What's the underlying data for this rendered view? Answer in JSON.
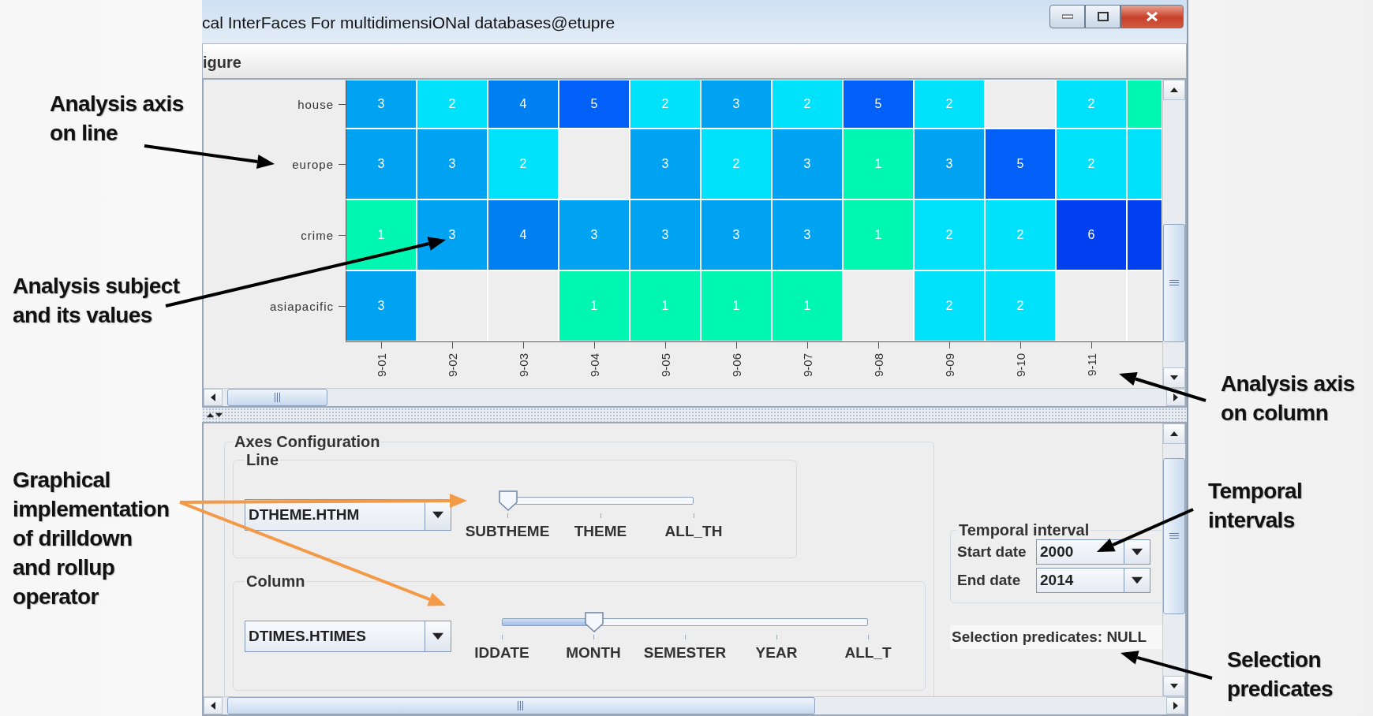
{
  "window": {
    "title": "cal InterFaces For multidimensiONal databases@etupre"
  },
  "menu": {
    "items": [
      "igure"
    ]
  },
  "heatmap": {
    "rows": [
      {
        "label": "house",
        "cells": [
          {
            "value": "3",
            "color": "#00a2f2"
          },
          {
            "value": "2",
            "color": "#00e2fc"
          },
          {
            "value": "4",
            "color": "#0080f0"
          },
          {
            "value": "5",
            "color": "#0060f8"
          },
          {
            "value": "2",
            "color": "#00e2fc"
          },
          {
            "value": "3",
            "color": "#00a2f2"
          },
          {
            "value": "2",
            "color": "#00e2fc"
          },
          {
            "value": "5",
            "color": "#0060f8"
          },
          {
            "value": "2",
            "color": "#00e2fc"
          },
          null,
          {
            "value": "2",
            "color": "#00e2fc"
          },
          {
            "color": "#00f7b2"
          }
        ]
      },
      {
        "label": "europe",
        "cells": [
          {
            "value": "3",
            "color": "#00a2f2"
          },
          {
            "value": "3",
            "color": "#00a2f2"
          },
          {
            "value": "2",
            "color": "#00e2fc"
          },
          null,
          {
            "value": "3",
            "color": "#00a2f2"
          },
          {
            "value": "2",
            "color": "#00e2fc"
          },
          {
            "value": "3",
            "color": "#00a2f2"
          },
          {
            "value": "1",
            "color": "#00f7b2"
          },
          {
            "value": "3",
            "color": "#00a2f2"
          },
          {
            "value": "5",
            "color": "#0060f8"
          },
          {
            "value": "2",
            "color": "#00e2fc"
          },
          {
            "color": "#00e2fc"
          }
        ]
      },
      {
        "label": "crime",
        "cells": [
          {
            "value": "1",
            "color": "#00f7b2"
          },
          {
            "value": "3",
            "color": "#00a2f2"
          },
          {
            "value": "4",
            "color": "#0080f0"
          },
          {
            "value": "3",
            "color": "#00a2f2"
          },
          {
            "value": "3",
            "color": "#00a2f2"
          },
          {
            "value": "3",
            "color": "#00a2f2"
          },
          {
            "value": "3",
            "color": "#00a2f2"
          },
          {
            "value": "1",
            "color": "#00f7b2"
          },
          {
            "value": "2",
            "color": "#00e2fc"
          },
          {
            "value": "2",
            "color": "#00e2fc"
          },
          {
            "value": "6",
            "color": "#0040f0"
          },
          {
            "color": "#0040f0"
          }
        ]
      },
      {
        "label": "asiapacific",
        "cells": [
          {
            "value": "3",
            "color": "#00a2f2"
          },
          null,
          null,
          {
            "value": "1",
            "color": "#00f7b2"
          },
          {
            "value": "1",
            "color": "#00f7b2"
          },
          {
            "value": "1",
            "color": "#00f7b2"
          },
          {
            "value": "1",
            "color": "#00f7b2"
          },
          null,
          {
            "value": "2",
            "color": "#00e2fc"
          },
          {
            "value": "2",
            "color": "#00e2fc"
          },
          null,
          null
        ]
      }
    ],
    "bottom_axis": {
      "tick_labels": [
        "9-01",
        "9-02",
        "9-03",
        "9-04",
        "9-05",
        "9-06",
        "9-07",
        "9-08",
        "9-09",
        "9-10",
        "9-11"
      ]
    }
  },
  "axes_configuration": {
    "title": "Axes Configuration",
    "line": {
      "title": "Line",
      "dimension": "DTHEME.HTHM",
      "slider": {
        "level": 0,
        "levels": [
          "SUBTHEME",
          "THEME",
          "ALL_TH"
        ]
      }
    },
    "column": {
      "title": "Column",
      "dimension": "DTIMES.HTIMES",
      "slider": {
        "level": 0.25,
        "levels": [
          "IDDATE",
          "MONTH",
          "SEMESTER",
          "YEAR",
          "ALL_T"
        ]
      }
    }
  },
  "temporal_interval": {
    "title": "Temporal interval",
    "fields": [
      {
        "label": "Start date",
        "value": "2000"
      },
      {
        "label": "End date",
        "value": "2014"
      }
    ]
  },
  "selection_predicates": "Selection predicates: NULL",
  "annotations": [
    {
      "lines": [
        "Analysis axis",
        "on line"
      ],
      "color": "#000000"
    },
    {
      "lines": [
        "Analysis subject",
        "and its values"
      ],
      "color": "#000000"
    },
    {
      "lines": [
        "Graphical",
        "implementation",
        "of drilldown",
        "and rollup",
        "operator"
      ],
      "color": "#f29a48"
    },
    {
      "lines": [
        "Analysis axis",
        "on column"
      ],
      "color": "#000000"
    },
    {
      "lines": [
        "Temporal",
        "intervals"
      ],
      "color": "#000000"
    },
    {
      "lines": [
        "Selection",
        "predicates"
      ],
      "color": "#000000"
    }
  ]
}
